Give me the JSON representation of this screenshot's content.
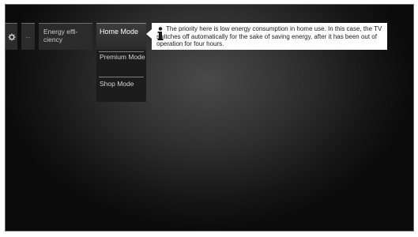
{
  "menu": {
    "gear_icon": "gear-icon",
    "more_label": "...",
    "energy_label": "Energy effi-ciency"
  },
  "dropdown": {
    "options": [
      {
        "label": "Home Mode",
        "selected": true
      },
      {
        "label": "Premium Mode",
        "selected": false
      },
      {
        "label": "Shop Mode",
        "selected": false
      }
    ]
  },
  "info": {
    "icon": "info-icon",
    "text": "The priority here is low energy consumption in home use. In this case, the TV switches off automatically for the sake of saving energy, after it has been out of operation for four hours."
  },
  "colors": {
    "info_background": "#ffffff",
    "selected_item": "#3c3c3c",
    "menu_background": "#2b2b2b"
  }
}
